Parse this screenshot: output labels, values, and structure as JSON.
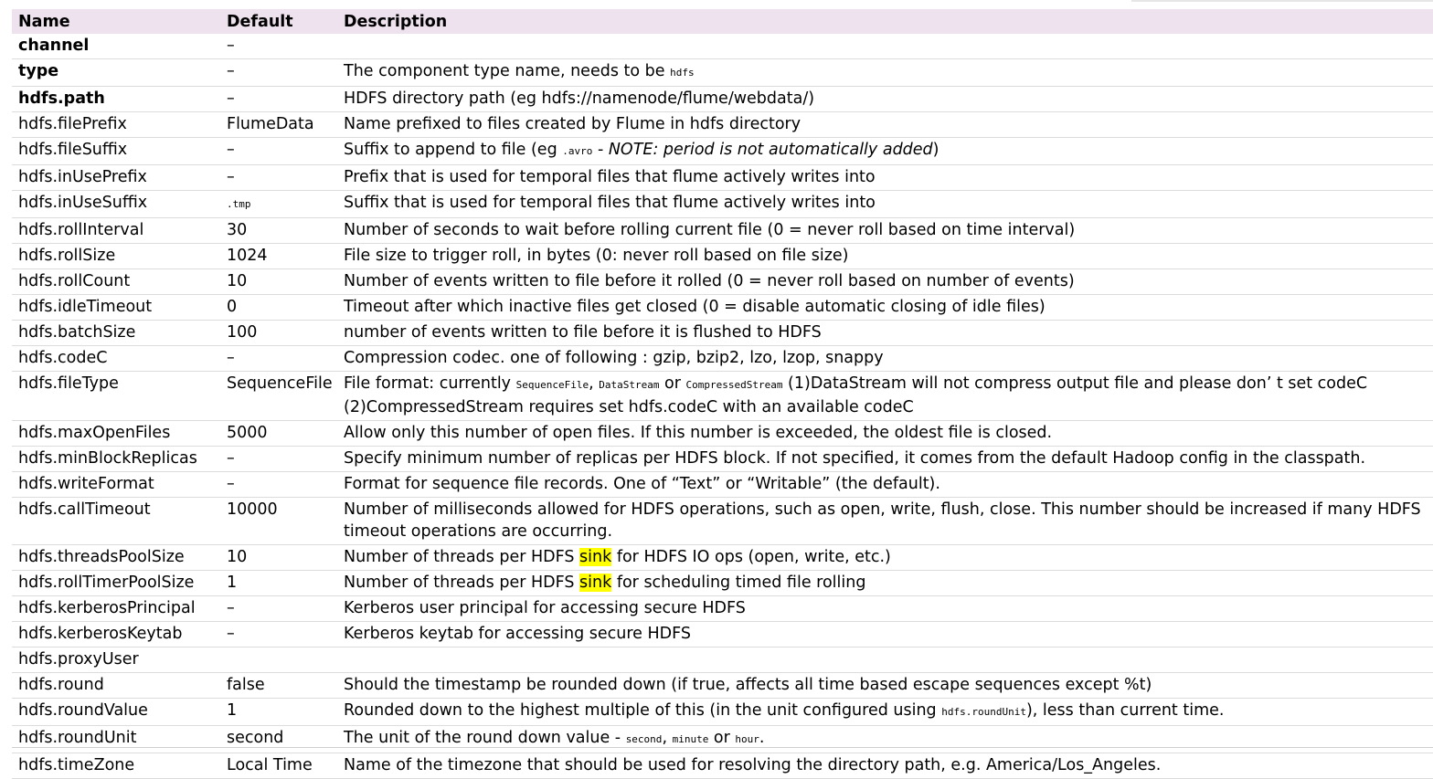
{
  "headers": {
    "name": "Name",
    "default": "Default",
    "description": "Description"
  },
  "rows": [
    {
      "name": "channel",
      "default": "–",
      "required": true,
      "desc": []
    },
    {
      "name": "type",
      "default": "–",
      "required": true,
      "desc": [
        {
          "t": "The component type name, needs to be "
        },
        {
          "t": "hdfs",
          "code": true
        }
      ]
    },
    {
      "name": "hdfs.path",
      "default": "–",
      "required": true,
      "desc": [
        {
          "t": "HDFS directory path (eg hdfs://namenode/flume/webdata/)"
        }
      ]
    },
    {
      "name": "hdfs.filePrefix",
      "default": "FlumeData",
      "desc": [
        {
          "t": "Name prefixed to files created by Flume in hdfs directory"
        }
      ]
    },
    {
      "name": "hdfs.fileSuffix",
      "default": "–",
      "desc": [
        {
          "t": "Suffix to append to file (eg "
        },
        {
          "t": ".avro",
          "code": true
        },
        {
          "t": " - "
        },
        {
          "t": "NOTE: period is not automatically added",
          "em": true
        },
        {
          "t": ")"
        }
      ]
    },
    {
      "name": "hdfs.inUsePrefix",
      "default": "–",
      "desc": [
        {
          "t": "Prefix that is used for temporal files that flume actively writes into"
        }
      ]
    },
    {
      "name": "hdfs.inUseSuffix",
      "default": ".tmp",
      "defaultCode": true,
      "desc": [
        {
          "t": "Suffix that is used for temporal files that flume actively writes into"
        }
      ]
    },
    {
      "name": "hdfs.rollInterval",
      "default": "30",
      "desc": [
        {
          "t": "Number of seconds to wait before rolling current file (0 = never roll based on time interval)"
        }
      ]
    },
    {
      "name": "hdfs.rollSize",
      "default": "1024",
      "desc": [
        {
          "t": "File size to trigger roll, in bytes (0: never roll based on file size)"
        }
      ]
    },
    {
      "name": "hdfs.rollCount",
      "default": "10",
      "desc": [
        {
          "t": "Number of events written to file before it rolled (0 = never roll based on number of events)"
        }
      ]
    },
    {
      "name": "hdfs.idleTimeout",
      "default": "0",
      "desc": [
        {
          "t": "Timeout after which inactive files get closed (0 = disable automatic closing of idle files)"
        }
      ]
    },
    {
      "name": "hdfs.batchSize",
      "default": "100",
      "desc": [
        {
          "t": "number of events written to file before it is flushed to HDFS"
        }
      ]
    },
    {
      "name": "hdfs.codeC",
      "default": "–",
      "desc": [
        {
          "t": "Compression codec. one of following : gzip, bzip2, lzo, lzop, snappy"
        }
      ]
    },
    {
      "name": "hdfs.fileType",
      "default": "SequenceFile",
      "desc": [
        {
          "t": "File format: currently "
        },
        {
          "t": "SequenceFile",
          "code": true
        },
        {
          "t": ", "
        },
        {
          "t": "DataStream",
          "code": true
        },
        {
          "t": " or "
        },
        {
          "t": "CompressedStream",
          "code": true
        },
        {
          "t": " (1)DataStream will not compress output file and please don’ t set codeC (2)CompressedStream requires set hdfs.codeC with an available codeC"
        }
      ]
    },
    {
      "name": "hdfs.maxOpenFiles",
      "default": "5000",
      "desc": [
        {
          "t": "Allow only this number of open files. If this number is exceeded, the oldest file is closed."
        }
      ]
    },
    {
      "name": "hdfs.minBlockReplicas",
      "default": "–",
      "desc": [
        {
          "t": "Specify minimum number of replicas per HDFS block. If not specified, it comes from the default Hadoop config in the classpath."
        }
      ]
    },
    {
      "name": "hdfs.writeFormat",
      "default": "–",
      "desc": [
        {
          "t": "Format for sequence file records. One of “Text” or “Writable” (the default)."
        }
      ]
    },
    {
      "name": "hdfs.callTimeout",
      "default": "10000",
      "desc": [
        {
          "t": "Number of milliseconds allowed for HDFS operations, such as open, write, flush, close. This number should be increased if many HDFS timeout operations are occurring."
        }
      ]
    },
    {
      "name": "hdfs.threadsPoolSize",
      "default": "10",
      "desc": [
        {
          "t": "Number of threads per HDFS "
        },
        {
          "t": "sink",
          "hl": true
        },
        {
          "t": " for HDFS IO ops (open, write, etc.)"
        }
      ]
    },
    {
      "name": "hdfs.rollTimerPoolSize",
      "default": "1",
      "desc": [
        {
          "t": "Number of threads per HDFS "
        },
        {
          "t": "sink",
          "hl": true
        },
        {
          "t": " for scheduling timed file rolling"
        }
      ]
    },
    {
      "name": "hdfs.kerberosPrincipal",
      "default": "–",
      "desc": [
        {
          "t": "Kerberos user principal for accessing secure HDFS"
        }
      ]
    },
    {
      "name": "hdfs.kerberosKeytab",
      "default": "–",
      "desc": [
        {
          "t": "Kerberos keytab for accessing secure HDFS"
        }
      ]
    },
    {
      "name": "hdfs.proxyUser",
      "default": "",
      "desc": []
    },
    {
      "name": "hdfs.round",
      "default": "false",
      "desc": [
        {
          "t": "Should the timestamp be rounded down (if true, affects all time based escape sequences except %t)"
        }
      ]
    },
    {
      "name": "hdfs.roundValue",
      "default": "1",
      "desc": [
        {
          "t": "Rounded down to the highest multiple of this (in the unit configured using "
        },
        {
          "t": "hdfs.roundUnit",
          "code": true
        },
        {
          "t": "), less than current time."
        }
      ]
    },
    {
      "name": "hdfs.roundUnit",
      "default": "second",
      "desc": [
        {
          "t": "The unit of the round down value - "
        },
        {
          "t": "second",
          "code": true
        },
        {
          "t": ", "
        },
        {
          "t": "minute",
          "code": true
        },
        {
          "t": " or "
        },
        {
          "t": "hour",
          "code": true
        },
        {
          "t": "."
        }
      ]
    },
    {
      "name": "hdfs.timeZone",
      "default": "Local Time",
      "desc": [
        {
          "t": "Name of the timezone that should be used for resolving the directory path, e.g. America/Los_Angeles."
        }
      ]
    }
  ],
  "colors": {
    "header_bg": "#efe2ef",
    "highlight": "#ffff00",
    "row_border": "#dcdcdc"
  }
}
